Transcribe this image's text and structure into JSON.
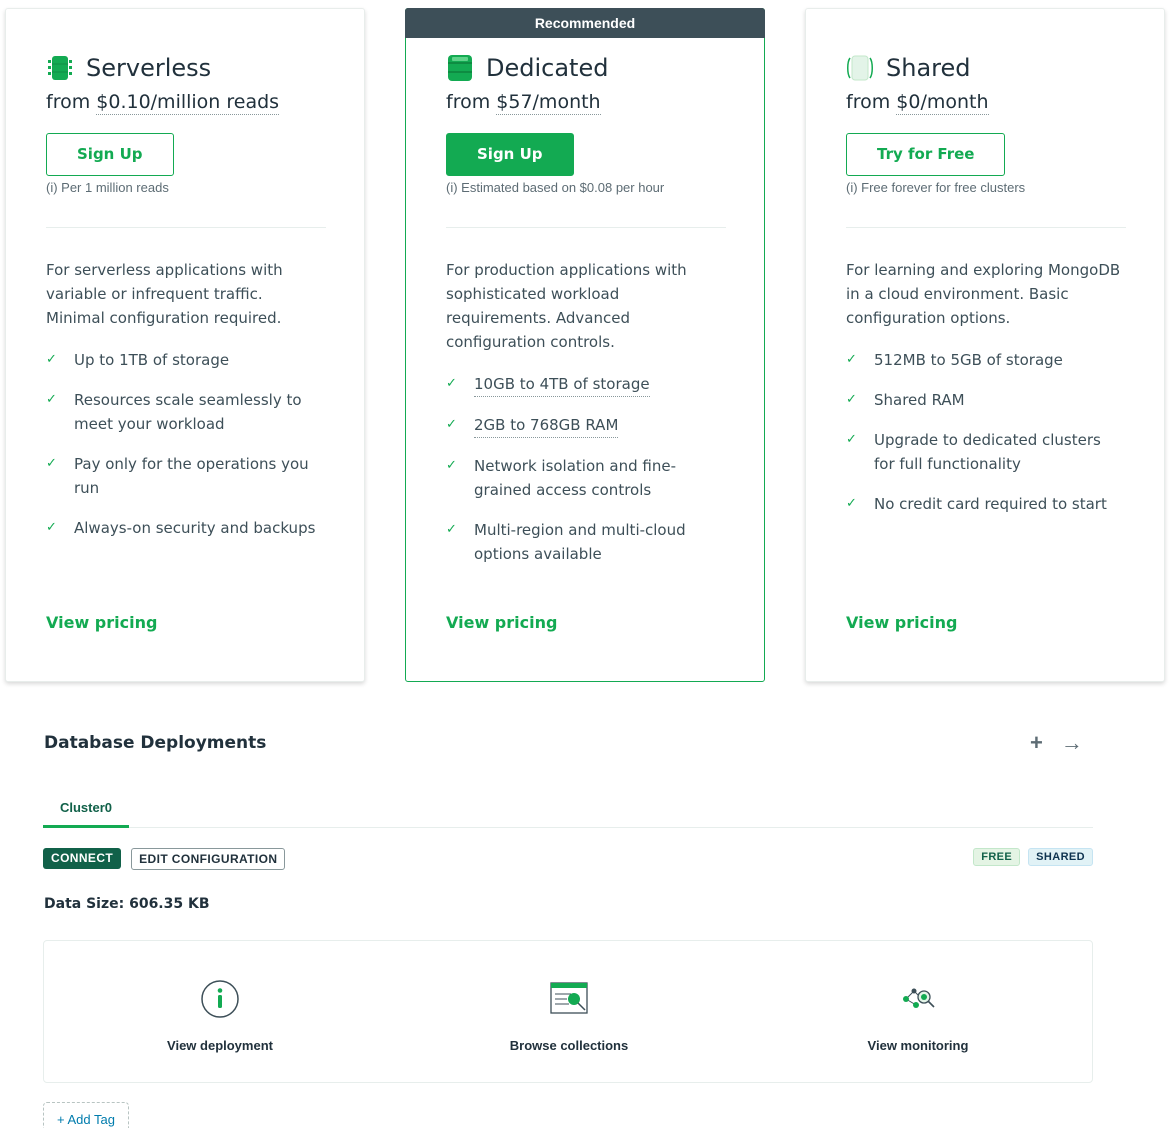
{
  "cards": {
    "serverless": {
      "title": "Serverless",
      "price_prefix": "from ",
      "price": "$0.10/million reads",
      "button": "Sign Up",
      "fine_print": "(i) Per 1 million reads",
      "description": "For serverless applications with variable or infrequent traffic. Minimal configuration required.",
      "features": [
        "Up to 1TB of storage",
        "Resources scale seamlessly to meet your workload",
        "Pay only for the operations you run",
        "Always-on security and backups"
      ],
      "link": "View pricing",
      "icon": "serverless-cluster-icon"
    },
    "dedicated": {
      "banner": "Recommended",
      "title": "Dedicated",
      "price_prefix": "from ",
      "price": "$57/month",
      "button": "Sign Up",
      "fine_print": "(i) Estimated based on $0.08 per hour",
      "description": "For production applications with sophisticated workload requirements. Advanced configuration controls.",
      "features": [
        "10GB to 4TB of storage",
        "2GB to 768GB RAM",
        "Network isolation and fine-grained access controls",
        "Multi-region and multi-cloud options available"
      ],
      "link": "View pricing",
      "icon": "dedicated-cluster-icon"
    },
    "shared": {
      "title": "Shared",
      "price_prefix": "from ",
      "price": "$0/month",
      "button": "Try for Free",
      "fine_print": "(i) Free forever for free clusters",
      "description": "For learning and exploring MongoDB in a cloud environment. Basic configuration options.",
      "features": [
        "512MB to 5GB of storage",
        "Shared RAM",
        "Upgrade to dedicated clusters for full functionality",
        "No credit card required to start"
      ],
      "link": "View pricing",
      "icon": "shared-cluster-icon"
    }
  },
  "deployments": {
    "title": "Database Deployments",
    "actions": [
      "plus-icon",
      "arrow-right-icon"
    ],
    "tab": "Cluster0",
    "connect": "CONNECT",
    "edit": "EDIT CONFIGURATION",
    "badges": [
      "FREE",
      "SHARED"
    ],
    "data_size": "Data Size: 606.35 KB",
    "panel_actions": [
      {
        "label": "View deployment",
        "icon": "info-icon"
      },
      {
        "label": "Browse collections",
        "icon": "browse-collections-icon"
      },
      {
        "label": "View monitoring",
        "icon": "monitoring-icon"
      }
    ],
    "add_tag": "+ Add Tag"
  },
  "colors": {
    "accent_green": "#13aa52",
    "dark_green": "#116149",
    "banner": "#3d4f58",
    "text": "#21313c"
  }
}
